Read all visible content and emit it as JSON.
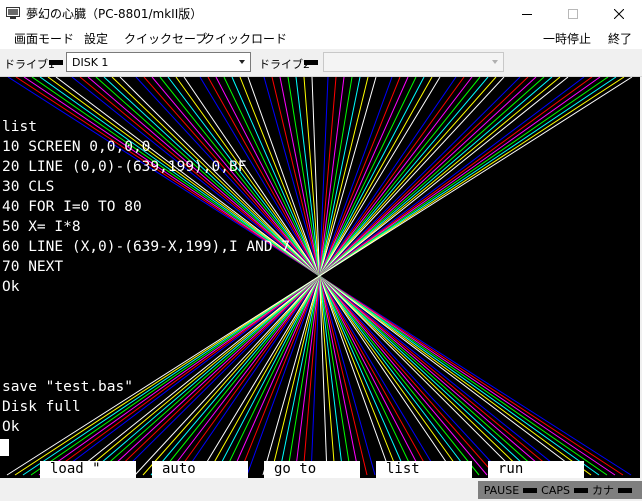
{
  "window": {
    "title": "夢幻の心臓（PC-8801/mkII版）",
    "controls": [
      "minimize",
      "maximize",
      "close"
    ]
  },
  "menu": {
    "left": [
      "画面モード",
      "設定",
      "クイックセーブ",
      "クイックロード"
    ],
    "pause": "一時停止",
    "exit": "終了"
  },
  "drives": {
    "drive1_label": "ドライブ1",
    "drive1_value": "DISK 1",
    "drive2_label": "ドライブ2",
    "drive2_value": ""
  },
  "screen": {
    "lines": [
      "list",
      "10 SCREEN 0,0,0,0",
      "20 LINE (0,0)-(639,199),0,BF",
      "30 CLS",
      "40 FOR I=0 TO 80",
      "50 X= I*8",
      "60 LINE (X,0)-(639-X,199),I AND 7",
      "70 NEXT",
      "Ok",
      "",
      "",
      "",
      "",
      "save \"test.bas\"",
      "Disk full",
      "Ok"
    ],
    "function_keys": [
      "load \"",
      "auto",
      "go to",
      "list",
      "run"
    ],
    "palette": [
      "#000000",
      "#0000ff",
      "#ff0000",
      "#ff00ff",
      "#00ff00",
      "#00ffff",
      "#ffff00",
      "#ffffff"
    ]
  },
  "status": {
    "pause": "PAUSE",
    "caps": "CAPS",
    "kana": "カナ"
  }
}
